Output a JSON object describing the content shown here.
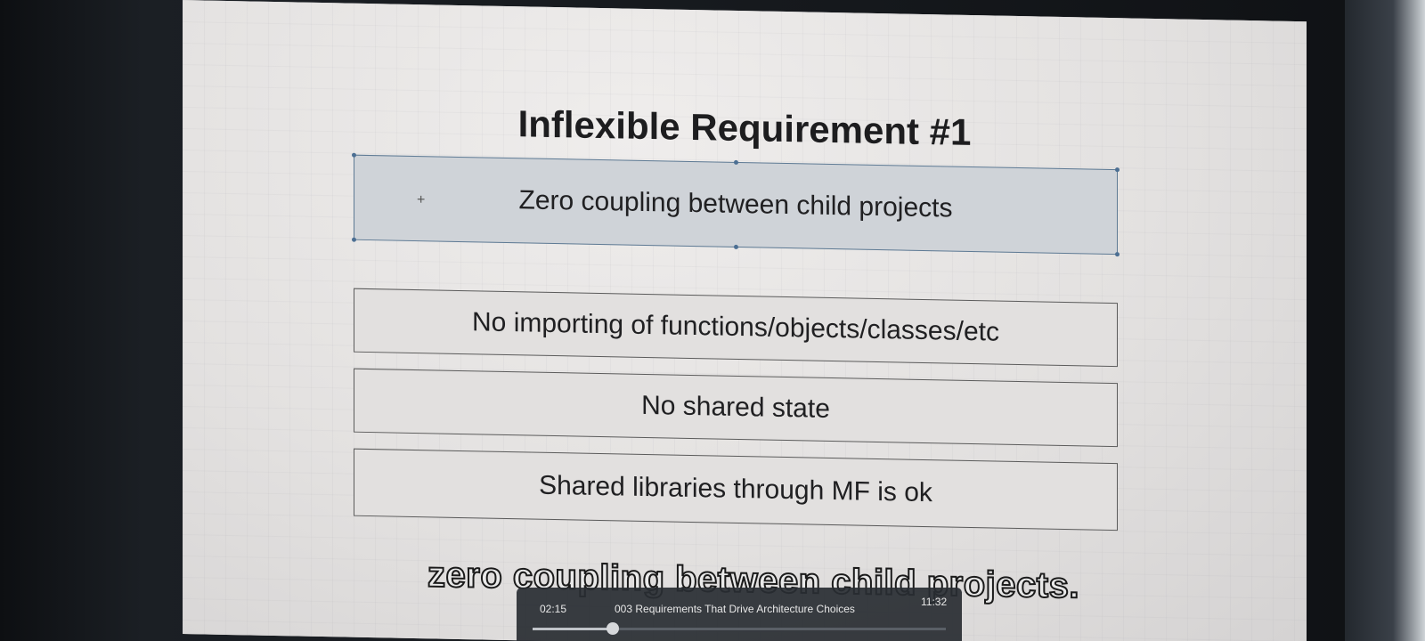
{
  "slide": {
    "title": "Inflexible Requirement #1",
    "selected_box": "Zero coupling between child projects",
    "boxes": [
      "No importing of functions/objects/classes/etc",
      "No shared state",
      "Shared libraries through MF is ok"
    ]
  },
  "subtitle": "zero coupling between child projects.",
  "player": {
    "current_time": "02:15",
    "video_title": "003 Requirements That Drive Architecture Choices",
    "total_time": "11:32",
    "progress_percent": 19.5
  },
  "colors": {
    "selected_box_bg": "#cfd3d8",
    "selection_handles": "#4c6f93",
    "slide_bg": "#e6e4e3"
  }
}
